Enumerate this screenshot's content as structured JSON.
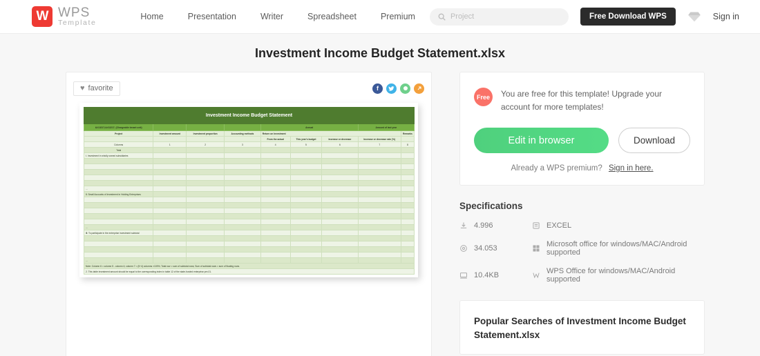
{
  "header": {
    "logo": {
      "mark": "W",
      "title": "WPS",
      "subtitle": "Template"
    },
    "nav": [
      {
        "label": "Home",
        "name": "nav-home"
      },
      {
        "label": "Presentation",
        "name": "nav-presentation"
      },
      {
        "label": "Writer",
        "name": "nav-writer"
      },
      {
        "label": "Spreadsheet",
        "name": "nav-spreadsheet"
      },
      {
        "label": "Premium",
        "name": "nav-premium"
      }
    ],
    "search": {
      "placeholder": "Project",
      "value": ""
    },
    "download_button": "Free Download WPS",
    "signin": "Sign in"
  },
  "page_title": "Investment Income Budget Statement.xlsx",
  "preview": {
    "favorite_label": "favorite",
    "socials": [
      {
        "name": "facebook-icon",
        "glyph": "f",
        "color": "#3b5998"
      },
      {
        "name": "twitter-icon",
        "glyph": "ᴛ",
        "color": "#40b3e8"
      },
      {
        "name": "whatsapp-icon",
        "glyph": "●",
        "color": "#6fd08c"
      },
      {
        "name": "share-link-icon",
        "glyph": "↗",
        "color": "#f3a03c"
      }
    ]
  },
  "sheet": {
    "title": "Investment Income Budget Statement",
    "group_headers": {
      "left": "&#13217;&#13217; (Chargeable tenant unit)",
      "annual": "Annual",
      "last_year": "Amount of last year"
    },
    "sub_headers": {
      "project": "Project",
      "investment_amount": "Investment amount",
      "investment_proportion": "Investment proportion",
      "accounting_methods": "Accounting methods",
      "return_on_investment": "Return on Investment",
      "remarks": "Remarks"
    },
    "leaf_headers": {
      "from_actual": "From the actual",
      "this_year_budget": "This year's budget",
      "increase_decrease": "Increase or decrease",
      "increase_decrease_rate": "Increase or decrease rate (%)"
    },
    "columns_label": "Columns",
    "column_numbers": [
      "1",
      "2",
      "3",
      "4",
      "5",
      "6",
      "7",
      "8"
    ],
    "total_label": "Total",
    "sections": [
      "Ⅰ. Investment in wholly owned subsidiaries",
      "Ⅱ. Small Accounts of Investment in Holding Enterprises",
      "Ⅲ. To participate in the enterprise investment subtotal"
    ],
    "ellipsis": "...",
    "notes": [
      "Note: Column 6 = column 5 - column 4; column 7 = (5÷4) columns ×100%; Total row = sum of subtotal rows; Sum of subtotal rows = sum of floating rows.",
      "2. This table investment amount should be equal to the corresponding index in table 12 of the state-funded enterprise pre-01."
    ]
  },
  "action": {
    "free_badge": "Free",
    "free_text": "You are free for this template! Upgrade your account for more templates!",
    "edit_button": "Edit in browser",
    "download_button": "Download",
    "premium_text": "Already a WPS premium?",
    "premium_link": "Sign in here."
  },
  "specifications": {
    "title": "Specifications",
    "items": [
      {
        "icon": "download-icon",
        "value": "4.996"
      },
      {
        "icon": "format-icon",
        "value": "EXCEL"
      },
      {
        "icon": "views-icon",
        "value": "34.053"
      },
      {
        "icon": "microsoft-icon",
        "value": "Microsoft office for windows/MAC/Android supported"
      },
      {
        "icon": "filesize-icon",
        "value": "10.4KB"
      },
      {
        "icon": "wps-icon",
        "value": "WPS Office for windows/MAC/Android supported"
      }
    ]
  },
  "popular": {
    "title": "Popular Searches of Investment Income Budget Statement.xlsx"
  }
}
